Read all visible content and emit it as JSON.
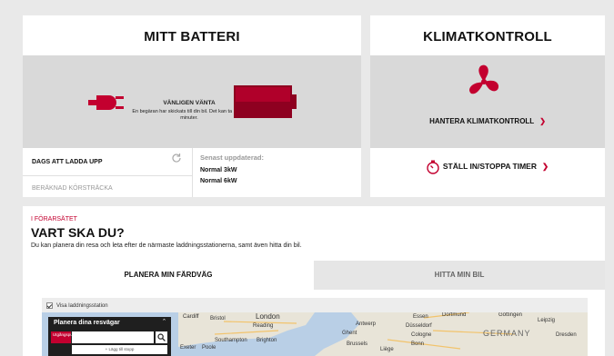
{
  "battery": {
    "title": "MITT BATTERI",
    "wait_title": "VÄNLIGEN VÄNTA",
    "wait_text": "En begäran har skickats till din bil. Det kan ta några minuter.",
    "charge_label": "DAGS ATT LADDA UPP",
    "range_label": "BERÄKNAD KÖRSTRÄCKA",
    "updated_label": "Senast uppdaterad:",
    "charge_normal_3": "Normal 3kW",
    "charge_normal_6": "Normal 6kW",
    "icons": [
      "plug-icon",
      "battery-icon",
      "refresh-icon"
    ]
  },
  "climate": {
    "title": "KLIMATKONTROLL",
    "manage_label": "HANTERA KLIMATKONTROLL",
    "timer_label": "STÄLL IN/STOPPA TIMER",
    "icons": [
      "fan-icon",
      "timer-icon",
      "chevron-right-icon"
    ]
  },
  "plan": {
    "kicker": "I FÖRARSÄTET",
    "title": "VART SKA DU?",
    "description": "Du kan planera din resa och leta efter de närmaste laddningsstationerna, samt även hitta din bil.",
    "tabs": [
      {
        "label": "PLANERA MIN FÄRDVÄG",
        "active": true
      },
      {
        "label": "HITTA MIN BIL",
        "active": false
      }
    ],
    "show_stations": "Visa laddningsstation",
    "route_title": "Planera dina resvägar",
    "start_tag": "Utgångspunkt",
    "add_stop": "+ Lägg till stopp",
    "map_labels": [
      "Cardiff",
      "Bristol",
      "London",
      "Reading",
      "Southampton",
      "Brighton",
      "Exeter",
      "Poole",
      "Essen",
      "Dortmund",
      "Düsseldorf",
      "Cologne",
      "Bonn",
      "GERMANY",
      "Leipzig",
      "Dresden",
      "Göttingen",
      "Antwerp",
      "Ghent",
      "Brussels",
      "Liège"
    ]
  },
  "colors": {
    "accent": "#c3002f",
    "battery_dark": "#8e0020",
    "panel_bg": "#ffffff",
    "grey_band": "#d9d9d9"
  }
}
